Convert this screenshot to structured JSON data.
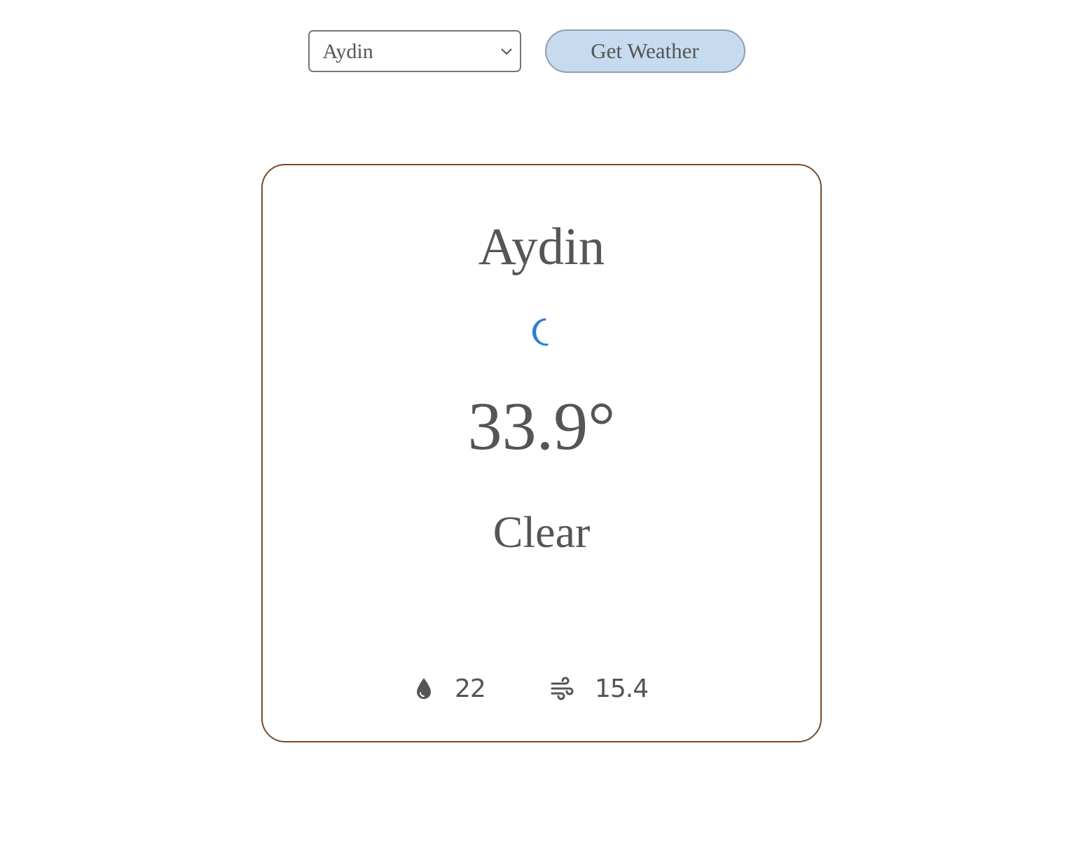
{
  "controls": {
    "city_select": {
      "selected": "Aydin"
    },
    "get_weather_label": "Get Weather"
  },
  "weather": {
    "city": "Aydin",
    "condition_icon": "moon-icon",
    "temperature": "33.9°",
    "description": "Clear",
    "humidity": {
      "icon": "water-drop-icon",
      "value": "22"
    },
    "wind": {
      "icon": "wind-icon",
      "value": "15.4"
    }
  },
  "colors": {
    "card_border": "#7a4a28",
    "button_bg": "#c6dbef",
    "text": "#555555",
    "moon_icon": "#2f7dd6"
  }
}
